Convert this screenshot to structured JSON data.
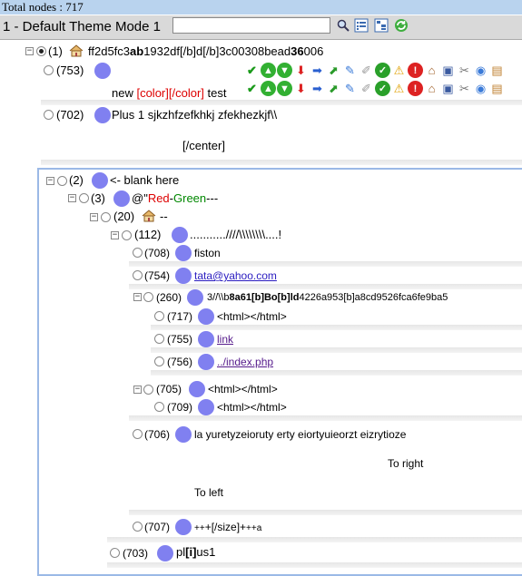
{
  "header": {
    "total_nodes": "Total nodes : 717",
    "theme_label": "1 - Default Theme Mode 1",
    "search_value": ""
  },
  "tree": {
    "n1": {
      "num": "(1)",
      "pre": "ff2d5fc3",
      "b1": "ab",
      "mid": "1932df[/b]d[/b]3c00308bead",
      "b2": "36",
      "post": "006"
    },
    "n753": {
      "num": "(753)",
      "text_a": "new ",
      "text_b": "[color][/color]",
      "text_c": " test"
    },
    "n702": {
      "num": "(702)",
      "text": "Plus 1 sjkzhfzefkhkj zfekhezkjf\\\\",
      "center": "[/center]"
    },
    "n2": {
      "num": "(2)",
      "text": "<- blank here"
    },
    "n3": {
      "num": "(3)",
      "pre": "@\"",
      "red": "Red",
      "dash": "-",
      "green": "Green",
      "post": "---"
    },
    "n20": {
      "num": "(20)",
      "text": "--"
    },
    "n112": {
      "num": "(112)",
      "text": "...........////\\\\\\\\\\\\\\\\....!"
    },
    "n708": {
      "num": "(708)",
      "text": "fiston"
    },
    "n754": {
      "num": "(754)",
      "text": "tata@yahoo.com"
    },
    "n260": {
      "num": "(260)",
      "pre": "3//\\\\b",
      "b1": "8a61[b]Bo[b]ld",
      "post": "4226a953[b]a8cd9526fca6fe9ba5"
    },
    "n717": {
      "num": "(717)",
      "text": "<html></html>"
    },
    "n755": {
      "num": "(755)",
      "text": "link"
    },
    "n756": {
      "num": "(756)",
      "text": "../index.php"
    },
    "n705": {
      "num": "(705)",
      "text": "<html></html>"
    },
    "n709": {
      "num": "(709)",
      "text": "<html></html>"
    },
    "n706": {
      "num": "(706)",
      "text": "la yuretyzeioruty erty eiortyuieorzt eizrytioze",
      "right": "To right",
      "left": "To left"
    },
    "n707": {
      "num": "(707)",
      "pre": "++",
      "mid": "+[/size]+",
      "post": "++a"
    },
    "n703": {
      "num": "(703)",
      "pre": "pl",
      "b": "[i]",
      "post": "us1"
    }
  },
  "icons": [
    "check-icon",
    "up-circle-icon",
    "down-circle-icon",
    "down-arrow-icon",
    "right-arrow-icon",
    "up-right-arrow-icon",
    "tag-icon",
    "pencil-icon",
    "ok-icon",
    "warning-icon",
    "stop-icon",
    "home-icon",
    "save-icon",
    "cut-icon",
    "eye-icon",
    "paste-icon"
  ],
  "colors": {
    "bubble": "#8080f0",
    "topbar": "#b9d3ee",
    "frame": "#9bb9e6"
  }
}
